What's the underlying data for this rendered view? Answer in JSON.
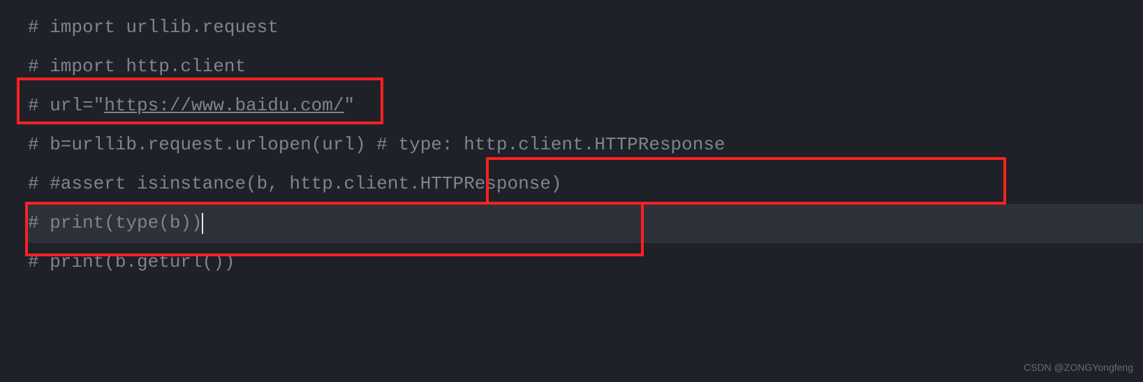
{
  "code": {
    "line1": "# import urllib.request",
    "line2": "# import http.client",
    "line3_prefix": "# url=\"",
    "line3_url": "https://www.baidu.com/",
    "line3_suffix": "\"",
    "line4": "# b=urllib.request.urlopen(url) # type: http.client.HTTPResponse",
    "line5": "# #assert isinstance(b, http.client.HTTPResponse)",
    "line6": "# print(type(b))",
    "line7": "# print(b.geturl())"
  },
  "watermark": "CSDN @ZONGYongfeng"
}
